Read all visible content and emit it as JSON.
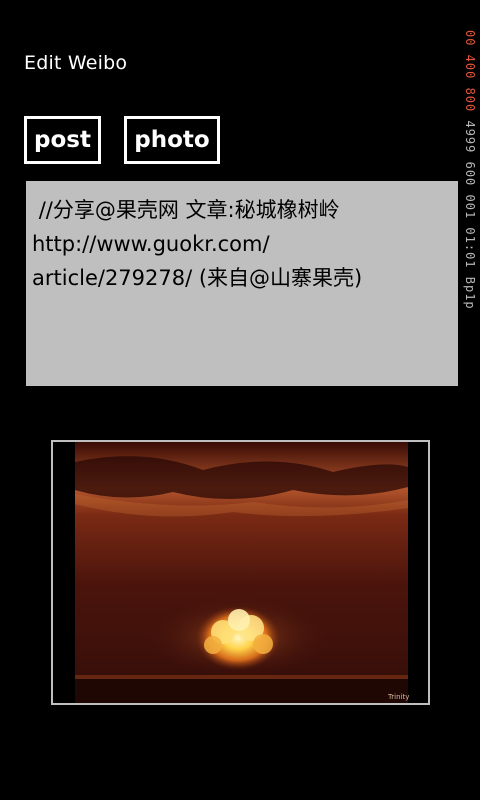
{
  "page": {
    "title": "Edit Weibo"
  },
  "buttons": {
    "post_label": "post",
    "photo_label": "photo"
  },
  "editor": {
    "text": " //分享@果壳网 文章:秘城橡树岭\nhttp://www.guokr.com/\narticle/279278/ (来自@山寨果壳)"
  },
  "attachment": {
    "image_name": "nuclear-explosion-photo"
  },
  "debug_overlay": {
    "accent_value": "00 400 800",
    "rest_value": "4999 600 001 01:01 Bp1p"
  },
  "colors": {
    "background": "#000000",
    "text_area_bg": "#bfbfbf",
    "overlay_accent": "#e2563a"
  }
}
